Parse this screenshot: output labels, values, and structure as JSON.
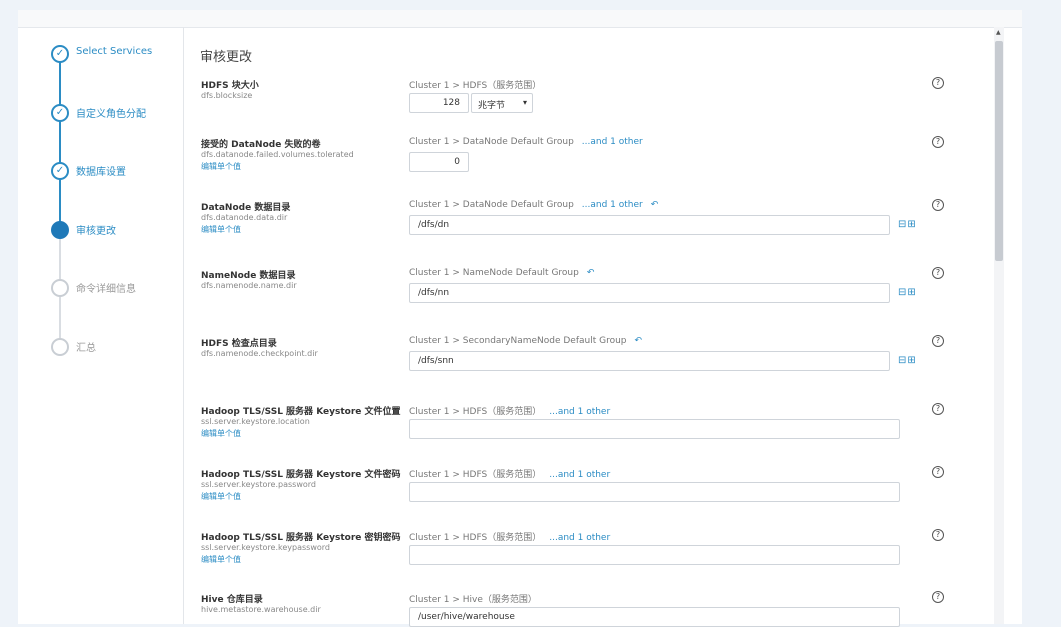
{
  "wizard": {
    "steps": [
      {
        "label": "Select Services",
        "state": "done"
      },
      {
        "label": "自定义角色分配",
        "state": "done"
      },
      {
        "label": "数据库设置",
        "state": "done"
      },
      {
        "label": "审核更改",
        "state": "active"
      },
      {
        "label": "命令详细信息",
        "state": "future"
      },
      {
        "label": "汇总",
        "state": "future"
      }
    ],
    "check_symbol": "✓"
  },
  "review": {
    "title": "审核更改",
    "help_symbol": "?",
    "undo_symbol": "↶",
    "minus_plus": "⊟⊞",
    "params": [
      {
        "name": "HDFS 块大小",
        "key": "dfs.blocksize",
        "link": "",
        "scope": "Cluster 1 > HDFS（服务范围）",
        "more": "",
        "undo": false,
        "value": "128",
        "unit": "兆字节",
        "unit_caret": "▾"
      },
      {
        "name": "接受的 DataNode 失败的卷",
        "key": "dfs.datanode.failed.volumes.tolerated",
        "link": "编辑单个值",
        "scope": "Cluster 1 > DataNode Default Group",
        "more": "...and 1 other",
        "undo": false,
        "value": "0"
      },
      {
        "name": "DataNode 数据目录",
        "key": "dfs.datanode.data.dir",
        "link": "编辑单个值",
        "scope": "Cluster 1 > DataNode Default Group",
        "more": "...and 1 other",
        "undo": true,
        "value": "/dfs/dn"
      },
      {
        "name": "NameNode 数据目录",
        "key": "dfs.namenode.name.dir",
        "link": "",
        "scope": "Cluster 1 > NameNode Default Group",
        "more": "",
        "undo": true,
        "value": "/dfs/nn"
      },
      {
        "name": "HDFS 检查点目录",
        "key": "dfs.namenode.checkpoint.dir",
        "link": "",
        "scope": "Cluster 1 > SecondaryNameNode Default Group",
        "more": "",
        "undo": true,
        "value": "/dfs/snn"
      },
      {
        "name": "Hadoop TLS/SSL 服务器 Keystore 文件位置",
        "key": "ssl.server.keystore.location",
        "link": "编辑单个值",
        "scope": "Cluster 1 > HDFS（服务范围）",
        "more": "...and 1 other",
        "undo": false,
        "value": ""
      },
      {
        "name": "Hadoop TLS/SSL 服务器 Keystore 文件密码",
        "key": "ssl.server.keystore.password",
        "link": "编辑单个值",
        "scope": "Cluster 1 > HDFS（服务范围）",
        "more": "...and 1 other",
        "undo": false,
        "value": ""
      },
      {
        "name": "Hadoop TLS/SSL 服务器 Keystore 密钥密码",
        "key": "ssl.server.keystore.keypassword",
        "link": "编辑单个值",
        "scope": "Cluster 1 > HDFS（服务范围）",
        "more": "...and 1 other",
        "undo": false,
        "value": ""
      },
      {
        "name": "Hive 仓库目录",
        "key": "hive.metastore.warehouse.dir",
        "link": "",
        "scope": "Cluster 1 > Hive（服务范围）",
        "more": "",
        "undo": false,
        "value": "/user/hive/warehouse"
      }
    ]
  },
  "scrollbar": {
    "up_arrow": "▲"
  }
}
